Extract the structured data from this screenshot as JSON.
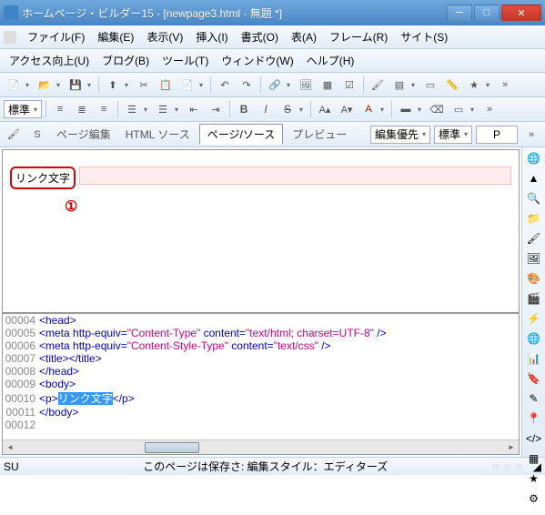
{
  "title": "ホームページ・ビルダー15 - [newpage3.html - 無題 *]",
  "menu1": {
    "file": "ファイル(F)",
    "edit": "編集(E)",
    "view": "表示(V)",
    "insert": "挿入(I)",
    "format": "書式(O)",
    "table": "表(A)",
    "frame": "フレーム(R)",
    "site": "サイト(S)"
  },
  "menu2": {
    "access": "アクセス向上(U)",
    "blog": "ブログ(B)",
    "tool": "ツール(T)",
    "window": "ウィンドウ(W)",
    "help": "ヘルプ(H)"
  },
  "combo_std": "標準",
  "tabs": {
    "page_edit": "ページ編集",
    "html_src": "HTML ソース",
    "page_src": "ページ/ソース",
    "preview": "プレビュー"
  },
  "right": {
    "edit_priority": "編集優先",
    "std": "標準",
    "p": "P"
  },
  "preview": {
    "link_text": "リンク文字",
    "annotation": "①"
  },
  "source": [
    {
      "n": "00004",
      "pre": "",
      "tag": "<head>",
      "post": ""
    },
    {
      "n": "00005",
      "pre": "",
      "tag": "<meta http-equiv=\"Content-Type\" content=\"text/html; charset=UTF-8\" />",
      "post": ""
    },
    {
      "n": "00006",
      "pre": "",
      "tag": "<meta http-equiv=\"Content-Style-Type\" content=\"text/css\" />",
      "post": ""
    },
    {
      "n": "00007",
      "pre": "",
      "tag": "<title></title>",
      "post": ""
    },
    {
      "n": "00008",
      "pre": "",
      "tag": "</head>",
      "post": ""
    },
    {
      "n": "00009",
      "pre": "",
      "tag": "<body>",
      "post": ""
    },
    {
      "n": "00010",
      "pre": "",
      "tag_open": "<p>",
      "sel": "リンク文字",
      "tag_close": "</p>"
    },
    {
      "n": "00011",
      "pre": "",
      "tag": "</body>",
      "post": ""
    },
    {
      "n": "00012",
      "pre": "",
      "tag": "",
      "post": ""
    }
  ],
  "status": {
    "left": "SU",
    "center": "このページは保存さ: 編集スタイル：エディターズ"
  },
  "chart_data": null
}
